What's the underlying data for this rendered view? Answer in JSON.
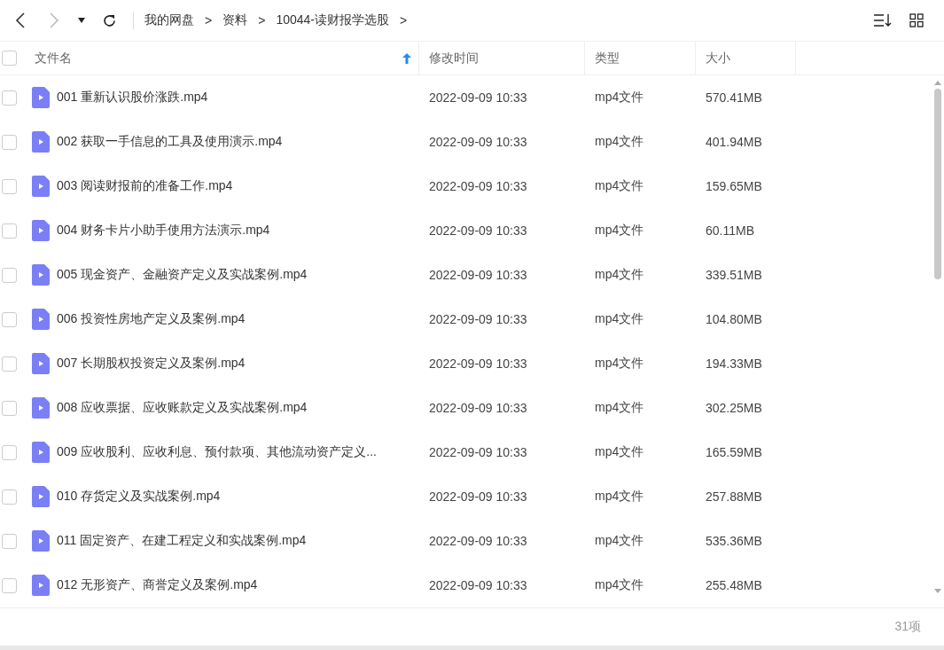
{
  "breadcrumb": [
    {
      "label": "我的网盘"
    },
    {
      "label": "资料"
    },
    {
      "label": "10044-读财报学选股"
    }
  ],
  "breadcrumb_separator": ">",
  "table": {
    "all_checked": false,
    "columns": [
      {
        "label": "文件名",
        "sorted": true
      },
      {
        "label": "修改时间",
        "sorted": false
      },
      {
        "label": "类型",
        "sorted": false
      },
      {
        "label": "大小",
        "sorted": false
      }
    ],
    "rows": [
      {
        "name": "001 重新认识股价涨跌.mp4",
        "modified": "2022-09-09 10:33",
        "type": "mp4文件",
        "size": "570.41MB",
        "checked": false
      },
      {
        "name": "002 获取一手信息的工具及使用演示.mp4",
        "modified": "2022-09-09 10:33",
        "type": "mp4文件",
        "size": "401.94MB",
        "checked": false
      },
      {
        "name": "003 阅读财报前的准备工作.mp4",
        "modified": "2022-09-09 10:33",
        "type": "mp4文件",
        "size": "159.65MB",
        "checked": false
      },
      {
        "name": "004 财务卡片小助手使用方法演示.mp4",
        "modified": "2022-09-09 10:33",
        "type": "mp4文件",
        "size": "60.11MB",
        "checked": false
      },
      {
        "name": "005 现金资产、金融资产定义及实战案例.mp4",
        "modified": "2022-09-09 10:33",
        "type": "mp4文件",
        "size": "339.51MB",
        "checked": false
      },
      {
        "name": "006 投资性房地产定义及案例.mp4",
        "modified": "2022-09-09 10:33",
        "type": "mp4文件",
        "size": "104.80MB",
        "checked": false
      },
      {
        "name": "007 长期股权投资定义及案例.mp4",
        "modified": "2022-09-09 10:33",
        "type": "mp4文件",
        "size": "194.33MB",
        "checked": false
      },
      {
        "name": "008 应收票据、应收账款定义及实战案例.mp4",
        "modified": "2022-09-09 10:33",
        "type": "mp4文件",
        "size": "302.25MB",
        "checked": false
      },
      {
        "name": "009 应收股利、应收利息、预付款项、其他流动资产定义...",
        "modified": "2022-09-09 10:33",
        "type": "mp4文件",
        "size": "165.59MB",
        "checked": false
      },
      {
        "name": "010 存货定义及实战案例.mp4",
        "modified": "2022-09-09 10:33",
        "type": "mp4文件",
        "size": "257.88MB",
        "checked": false
      },
      {
        "name": "011 固定资产、在建工程定义和实战案例.mp4",
        "modified": "2022-09-09 10:33",
        "type": "mp4文件",
        "size": "535.36MB",
        "checked": false
      },
      {
        "name": "012 无形资产、商誉定义及案例.mp4",
        "modified": "2022-09-09 10:33",
        "type": "mp4文件",
        "size": "255.48MB",
        "checked": false
      }
    ]
  },
  "status_bar": {
    "count": "31项"
  }
}
